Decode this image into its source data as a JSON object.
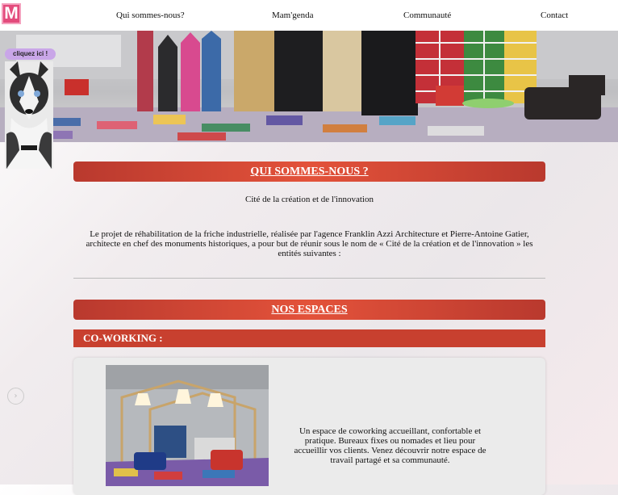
{
  "nav": {
    "logo_letter": "M",
    "items": [
      "Qui sommes-nous?",
      "Mam'genda",
      "Communauté",
      "Contact"
    ]
  },
  "dog_widget": {
    "badge": "cliquez ici !"
  },
  "about": {
    "heading": "QUI SOMMES-NOUS ?",
    "subtitle": "Cité de la création et de l'innovation",
    "paragraph": "Le projet de réhabilitation de la friche industrielle, réalisée par l'agence Franklin Azzi Architecture et Pierre-Antoine Gatier, architecte en chef des monuments historiques, a pour but de réunir sous le nom de « Cité de la création et de l'innovation » les entités suivantes :"
  },
  "spaces": {
    "heading": "NOS ESPACES",
    "coworking": {
      "title": "CO-WORKING :",
      "description": "Un espace de coworking accueillant, confortable et pratique. Bureaux fixes ou nomades et lieu pour accueillir vos clients. Venez découvrir notre espace de travail partagé et sa communauté."
    }
  },
  "scroll_icon": "arrow-circle-icon"
}
